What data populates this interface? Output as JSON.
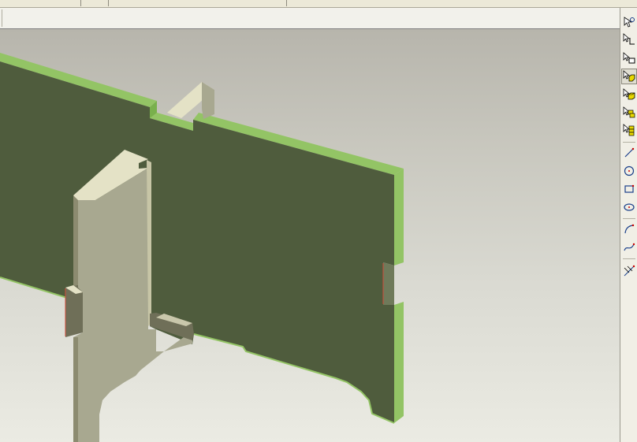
{
  "viewport": {
    "background_top": "#b7b5ac",
    "background_bottom": "#ebebe3",
    "colors": {
      "green_face": "#4f5c3d",
      "green_edge": "#93c465",
      "green_edge_dark": "#79b04c",
      "tan_face": "#a8a890",
      "tan_top": "#e4e2c6",
      "tan_side": "#6f6f58",
      "tan_dark": "#8c8b70",
      "highlight_red": "#d24b3a"
    }
  },
  "right_toolbar": {
    "tools": [
      {
        "name": "point-select-icon"
      },
      {
        "name": "edge-select-icon"
      },
      {
        "name": "face-select-icon"
      },
      {
        "name": "solid-select-icon",
        "active": true
      },
      {
        "name": "part-select-icon"
      },
      {
        "name": "component-select-icon"
      },
      {
        "name": "assembly-select-icon"
      },
      {
        "name": "line-icon"
      },
      {
        "name": "circle-icon"
      },
      {
        "name": "rectangle-icon"
      },
      {
        "name": "ellipse-icon"
      },
      {
        "name": "arc-icon"
      },
      {
        "name": "spline-icon"
      },
      {
        "name": "dimension-icon"
      }
    ]
  }
}
